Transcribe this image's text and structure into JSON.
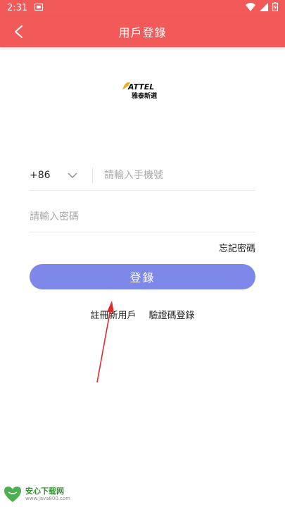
{
  "status": {
    "time": "2:31"
  },
  "header": {
    "title": "用戶登錄"
  },
  "logo": {
    "brand": "ATTEL",
    "subtitle": "雅泰新選"
  },
  "form": {
    "country_code": "+86",
    "phone_placeholder": "請輸入手機號",
    "password_placeholder": "請輸入密碼",
    "forgot_label": "忘記密碼",
    "login_label": "登錄"
  },
  "links": {
    "register": "註冊新用戶",
    "code_login": "驗證碼登錄"
  },
  "watermark": {
    "name": "安心下载网",
    "url": "www.java800.com"
  },
  "colors": {
    "primary": "#f25a5a",
    "button": "#7e88e8",
    "arrow": "#d92c2c"
  }
}
